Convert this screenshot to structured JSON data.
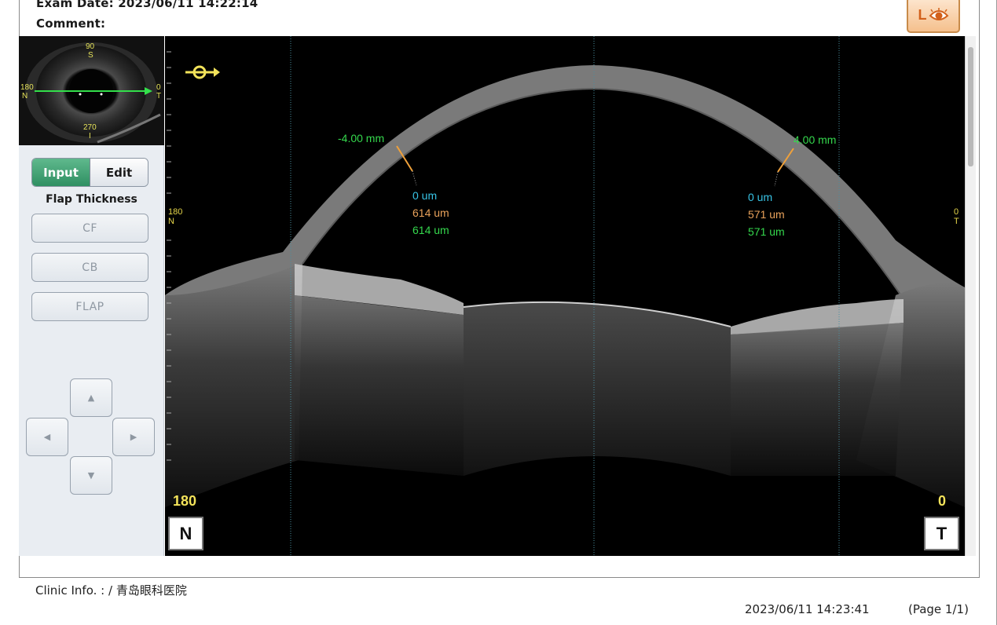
{
  "header": {
    "exam_label": "Exam Date:",
    "exam_value": "2023/06/11 14:22:14",
    "comment_label": "Comment:",
    "comment_value": "",
    "eye_badge": "L"
  },
  "thumbnail": {
    "top_label": "90",
    "top_letter": "S",
    "left_label": "180",
    "left_letter": "N",
    "right_label": "0",
    "right_letter": "T",
    "bottom_label": "270",
    "bottom_letter": "I"
  },
  "left_panel": {
    "mode_input": "Input",
    "mode_edit": "Edit",
    "section_title": "Flap Thickness",
    "buttons": [
      "CF",
      "CB",
      "FLAP"
    ],
    "arrows": {
      "up": "▲",
      "left": "◀",
      "right": "▶",
      "down": "▼"
    }
  },
  "scan": {
    "left_meas": {
      "pos": "-4.00 mm",
      "cyan": "0 um",
      "orange": "614 um",
      "green": "614 um"
    },
    "right_meas": {
      "pos": "4.00 mm",
      "cyan": "0 um",
      "orange": "571 um",
      "green": "571 um"
    },
    "left_side_num": "180",
    "left_side_letter": "N",
    "right_side_num": "0",
    "right_side_letter": "T",
    "bottom_left_num": "180",
    "bottom_right_num": "0",
    "dir_left": "N",
    "dir_right": "T"
  },
  "footer": {
    "clinic_label": "Clinic Info. :",
    "clinic_value": "/ 青岛眼科医院",
    "timestamp": "2023/06/11 14:23:41",
    "page": "(Page 1/1)"
  },
  "colors": {
    "accent_green": "#35d84d",
    "cyan": "#38c4e6",
    "orange": "#e9a25b",
    "yellow": "#f3e35a"
  }
}
